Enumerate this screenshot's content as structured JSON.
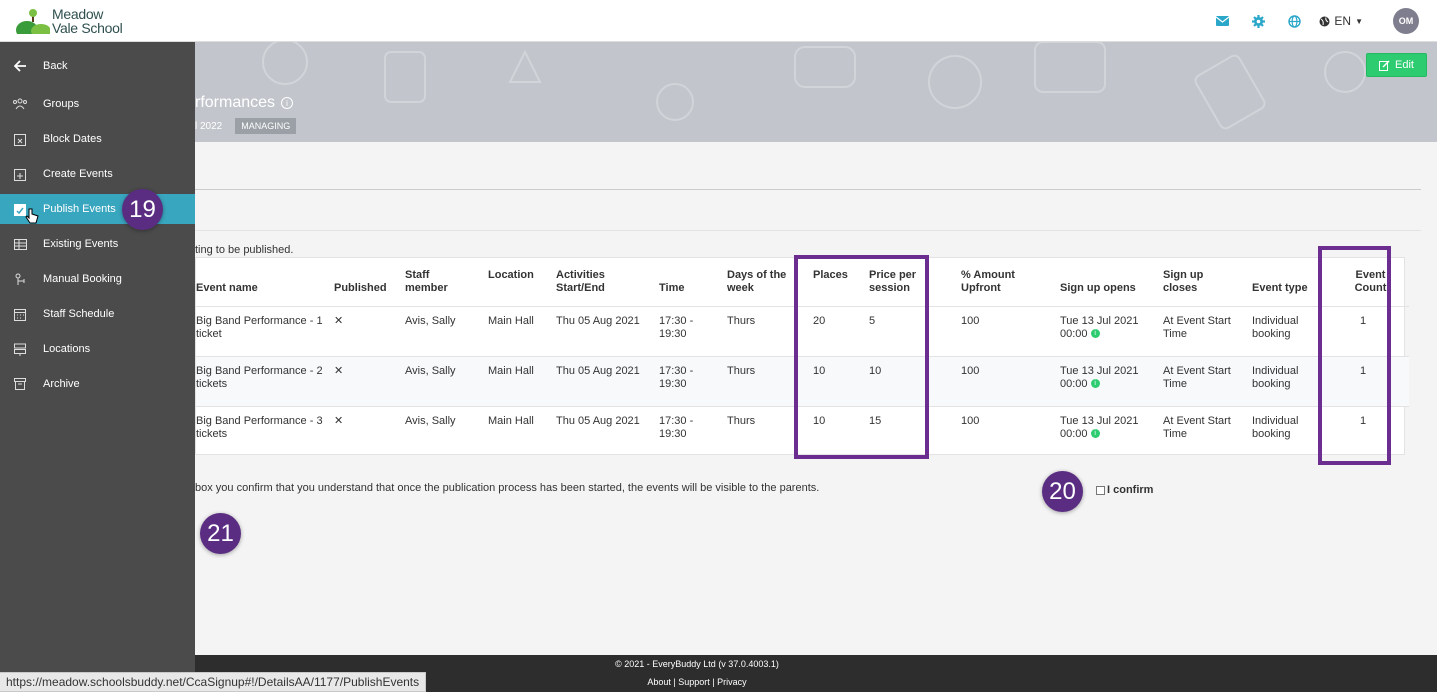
{
  "header": {
    "logo_line1": "Meadow",
    "logo_line2": "Vale School",
    "lang": "EN",
    "avatar": "OM",
    "icons": [
      "envelope-icon",
      "gear-icon",
      "globe-icon"
    ]
  },
  "banner": {
    "title": "rformances",
    "date": "l 2022",
    "badge": "MANAGING",
    "edit_label": "Edit"
  },
  "sidebar": {
    "items": [
      {
        "label": "Back",
        "icon": "arrow-left-icon"
      },
      {
        "label": "Groups",
        "icon": "users-icon"
      },
      {
        "label": "Block Dates",
        "icon": "calendar-x-icon"
      },
      {
        "label": "Create Events",
        "icon": "calendar-plus-icon"
      },
      {
        "label": "Publish Events",
        "icon": "calendar-check-icon"
      },
      {
        "label": "Existing Events",
        "icon": "table-icon"
      },
      {
        "label": "Manual Booking",
        "icon": "booking-icon"
      },
      {
        "label": "Staff Schedule",
        "icon": "calendar-icon"
      },
      {
        "label": "Locations",
        "icon": "signpost-icon"
      },
      {
        "label": "Archive",
        "icon": "archive-icon"
      }
    ]
  },
  "content": {
    "waiting_text": "ting to be published.",
    "confirm_text": "box you confirm that you understand that once the publication process has been started, the events will be visible to the parents.",
    "confirm_label": "I confirm"
  },
  "table": {
    "headers": [
      "Event name",
      "Published",
      "Staff member",
      "Location",
      "Activities Start/End",
      "Time",
      "Days of the week",
      "Places",
      "Price per session",
      "% Amount Upfront",
      "Sign up opens",
      "Sign up closes",
      "Event type",
      "Event Count"
    ],
    "rows": [
      {
        "event_name": "Big Band Performance - 1 ticket",
        "published": "✕",
        "staff": "Avis, Sally",
        "location": "Main Hall",
        "dates": "Thu 05 Aug 2021",
        "time": "17:30 - 19:30",
        "days": "Thurs",
        "places": "20",
        "price": "5",
        "upfront": "100",
        "opens_date": "Tue 13 Jul 2021",
        "opens_time": "00:00",
        "closes": "At Event Start Time",
        "type": "Individual booking",
        "count": "1"
      },
      {
        "event_name": "Big Band Performance - 2 tickets",
        "published": "✕",
        "staff": "Avis, Sally",
        "location": "Main Hall",
        "dates": "Thu 05 Aug 2021",
        "time": "17:30 - 19:30",
        "days": "Thurs",
        "places": "10",
        "price": "10",
        "upfront": "100",
        "opens_date": "Tue 13 Jul 2021",
        "opens_time": "00:00",
        "closes": "At Event Start Time",
        "type": "Individual booking",
        "count": "1"
      },
      {
        "event_name": "Big Band Performance - 3 tickets",
        "published": "✕",
        "staff": "Avis, Sally",
        "location": "Main Hall",
        "dates": "Thu 05 Aug 2021",
        "time": "17:30 - 19:30",
        "days": "Thurs",
        "places": "10",
        "price": "15",
        "upfront": "100",
        "opens_date": "Tue 13 Jul 2021",
        "opens_time": "00:00",
        "closes": "At Event Start Time",
        "type": "Individual booking",
        "count": "1"
      }
    ]
  },
  "markers": [
    "19",
    "20",
    "21"
  ],
  "footer": {
    "copyright": "© 2021 - EveryBuddy Ltd (v 37.0.4003.1)",
    "links": [
      "About",
      "Support",
      "Privacy"
    ]
  },
  "status_url": "https://meadow.schoolsbuddy.net/CcaSignup#!/DetailsAA/1177/PublishEvents",
  "colors": {
    "accent": "#39a6bf",
    "highlight": "#6b2d90",
    "edit_button": "#2ecc71",
    "sidebar_bg": "#4b4b4b"
  }
}
